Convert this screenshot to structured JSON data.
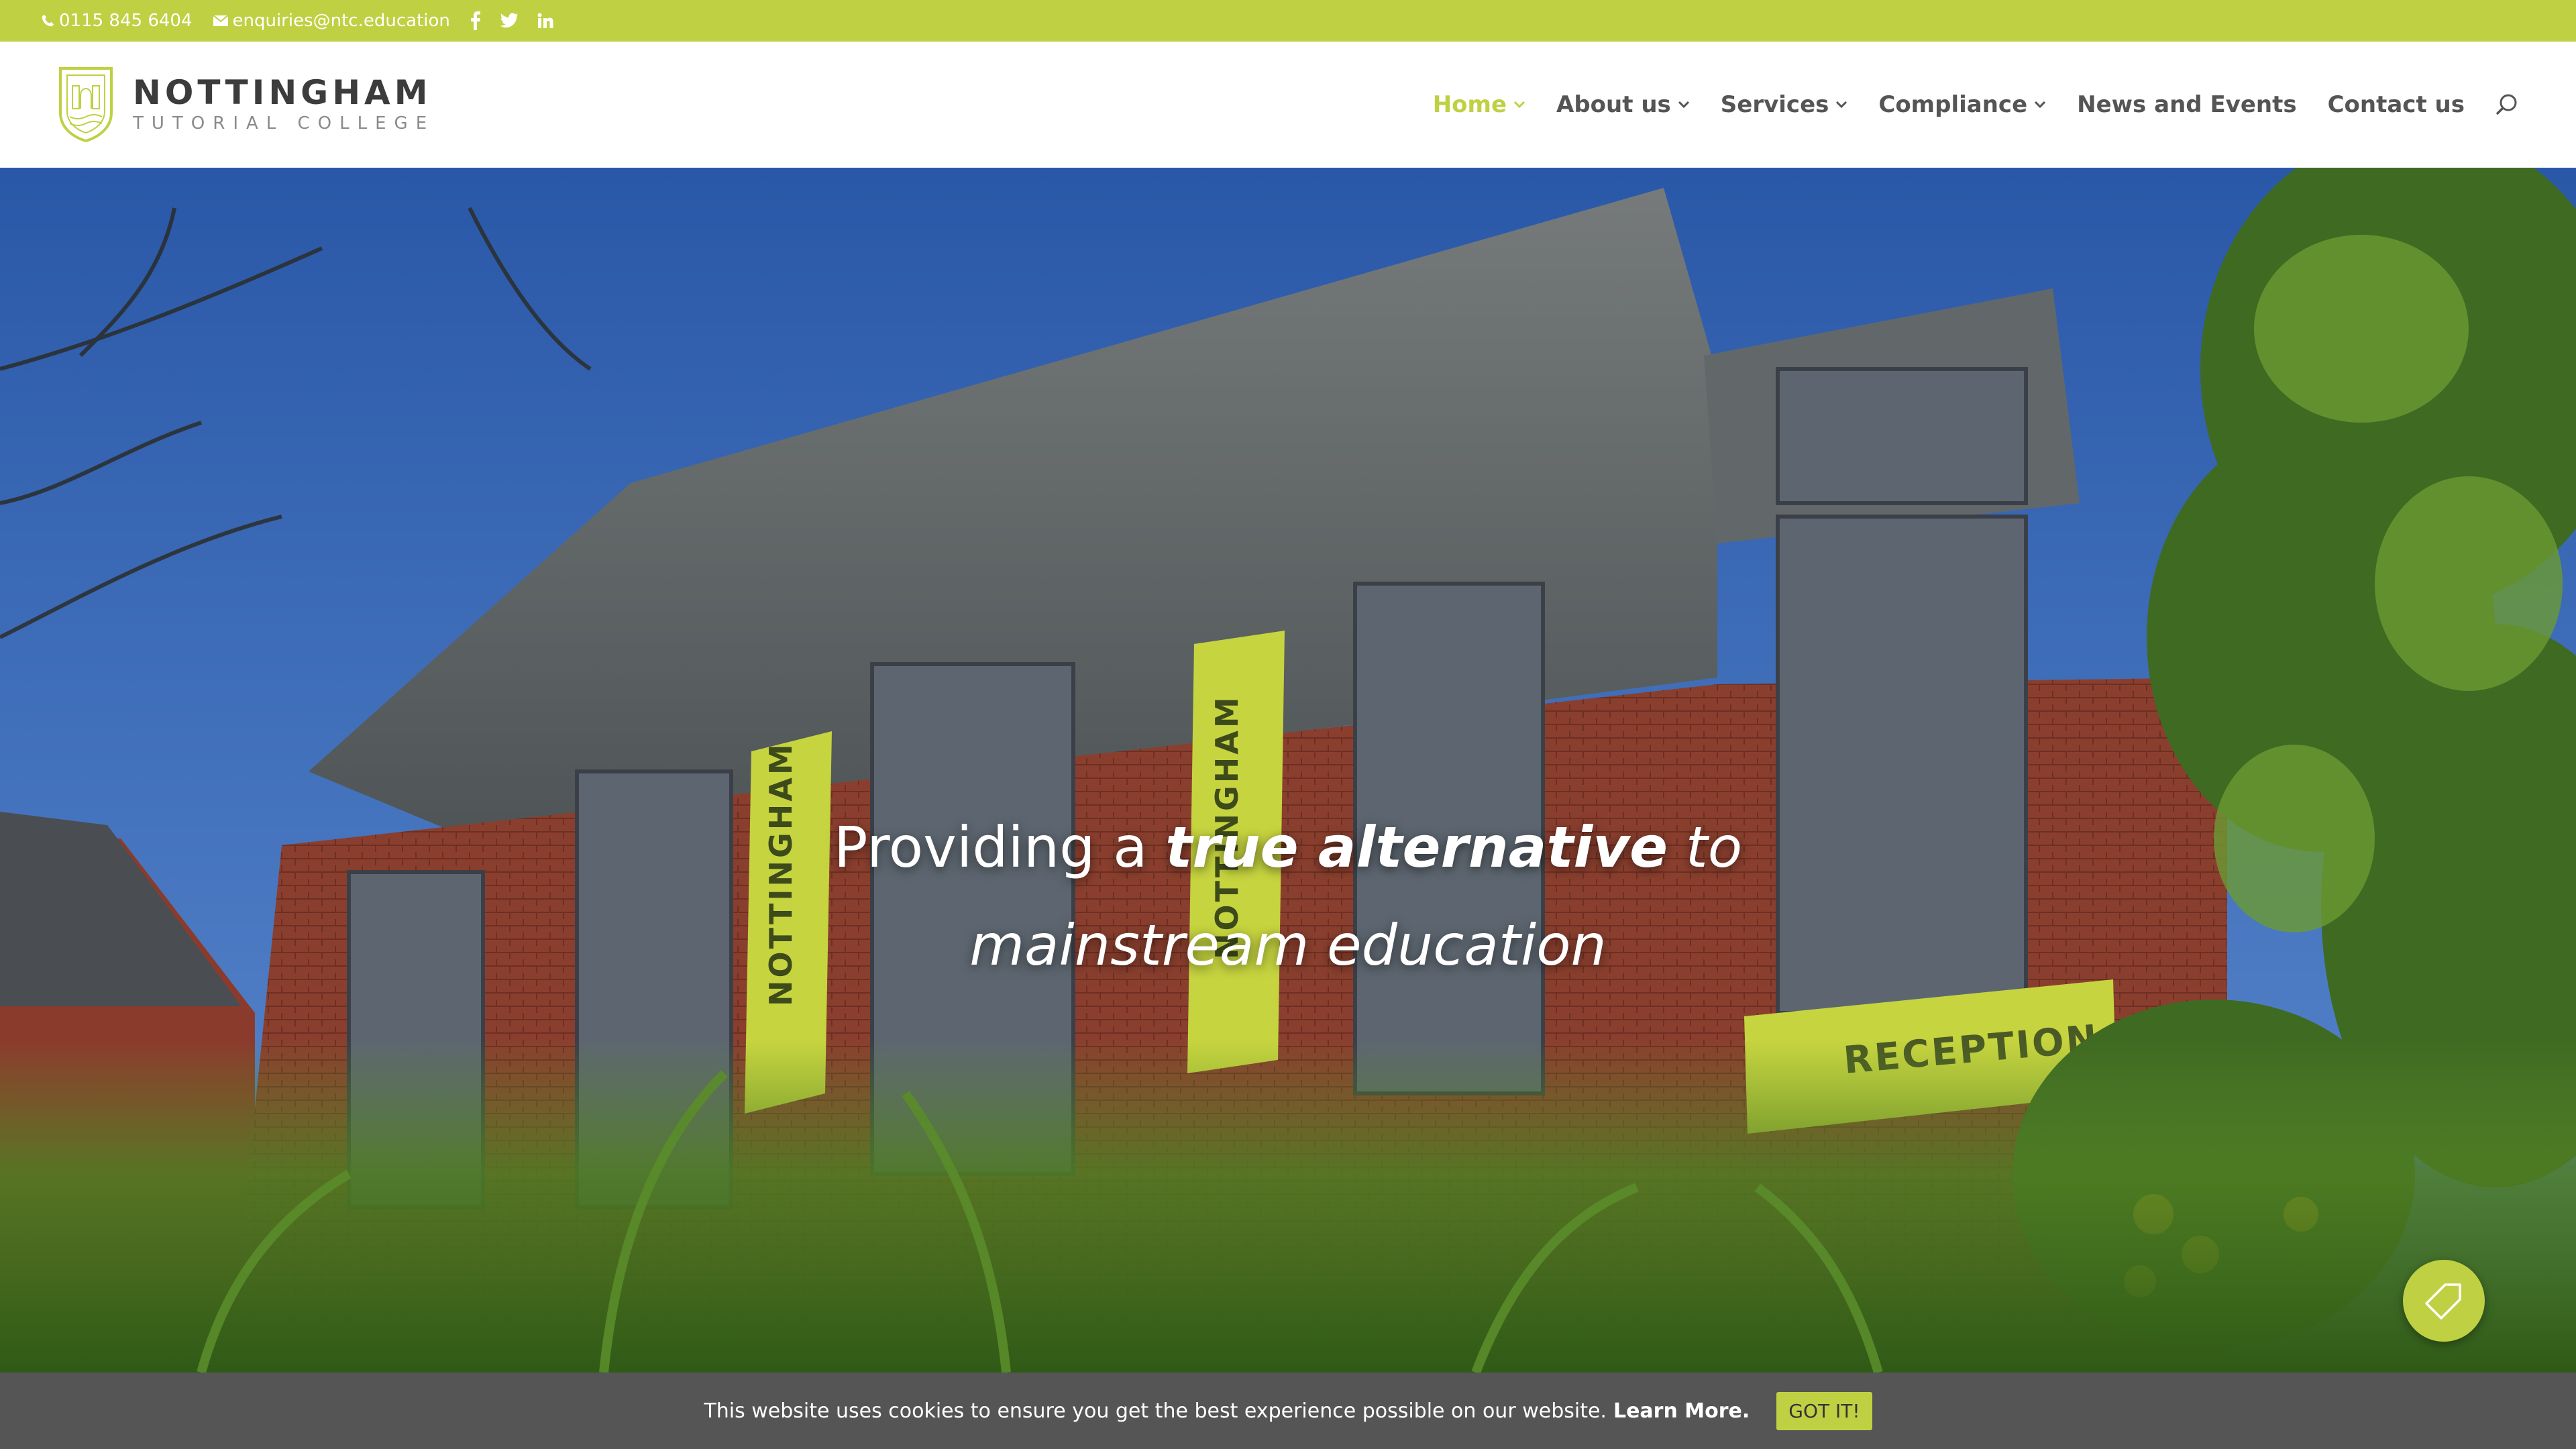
{
  "topbar": {
    "phone": "0115 845 6404",
    "email": "enquiries@ntc.education",
    "social": [
      "facebook-icon",
      "twitter-icon",
      "linkedin-icon"
    ],
    "background": "#bfd143"
  },
  "logo": {
    "title": "NOTTINGHAM",
    "subtitle": "TUTORIAL COLLEGE"
  },
  "nav": {
    "items": [
      {
        "label": "Home",
        "active": true,
        "dropdown": true
      },
      {
        "label": "About us",
        "dropdown": true
      },
      {
        "label": "Services",
        "dropdown": true
      },
      {
        "label": "Compliance",
        "dropdown": true
      },
      {
        "label": "News and Events",
        "dropdown": false
      },
      {
        "label": "Contact us",
        "dropdown": false
      }
    ],
    "accent": "#bfd143"
  },
  "hero": {
    "line1_prefix": "Providing a ",
    "line1_emphasis": "true alternative",
    "line1_suffix": " to",
    "line2": "mainstream education",
    "banner_text": "NOTTINGHAM",
    "banner_sub": "TUTORIAL COLLEGE",
    "reception_sign": "RECEPTION"
  },
  "cookie": {
    "message": "This website uses cookies to ensure you get the best experience possible on our website.",
    "learn_more": "Learn More.",
    "button": "GOT IT!"
  }
}
